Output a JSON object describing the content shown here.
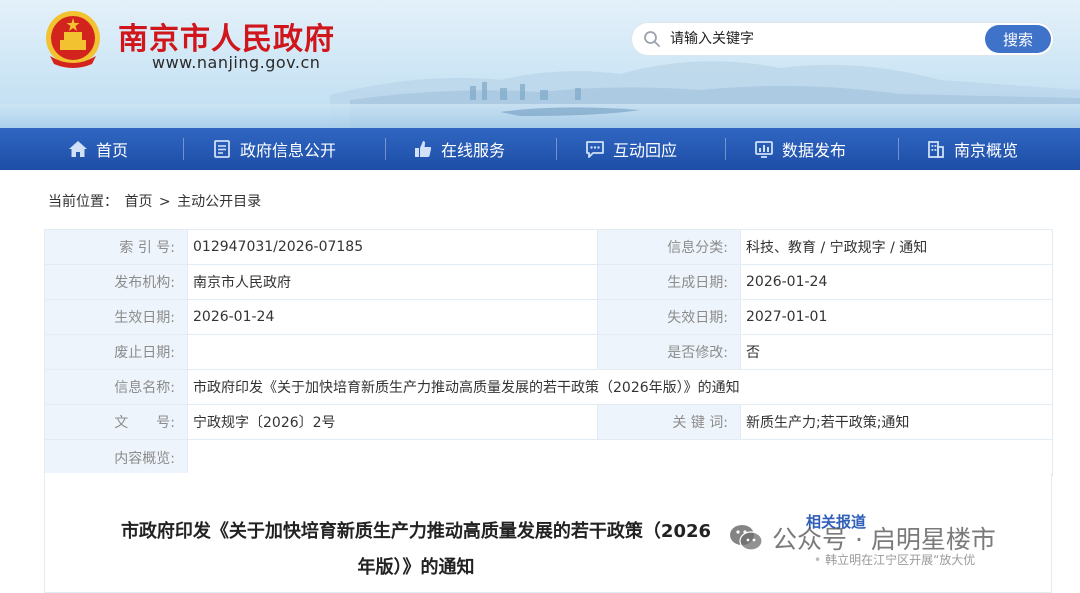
{
  "header": {
    "site_title": "南京市人民政府",
    "site_url": "www.nanjing.gov.cn",
    "emblem_icon": "national-emblem-icon",
    "search": {
      "placeholder": "请输入关键字",
      "button_label": "搜索"
    }
  },
  "nav": {
    "items": [
      {
        "label": "首页",
        "icon": "home-icon"
      },
      {
        "label": "政府信息公开",
        "icon": "document-icon"
      },
      {
        "label": "在线服务",
        "icon": "thumbs-up-icon"
      },
      {
        "label": "互动回应",
        "icon": "chat-icon"
      },
      {
        "label": "数据发布",
        "icon": "bar-chart-icon"
      },
      {
        "label": "南京概览",
        "icon": "building-icon"
      }
    ]
  },
  "breadcrumb": {
    "prefix": "当前位置：",
    "items": [
      "首页",
      "主动公开目录"
    ],
    "separator": ">"
  },
  "info": {
    "index_no": {
      "label": "索 引 号:",
      "value": "012947031/2026-07185"
    },
    "category": {
      "label": "信息分类:",
      "value": "科技、教育 / 宁政规字 / 通知"
    },
    "publisher": {
      "label": "发布机构:",
      "value": "南京市人民政府"
    },
    "created_date": {
      "label": "生成日期:",
      "value": "2026-01-24"
    },
    "effective_date": {
      "label": "生效日期:",
      "value": "2026-01-24"
    },
    "expiry_date": {
      "label": "失效日期:",
      "value": "2027-01-01"
    },
    "repeal_date": {
      "label": "废止日期:",
      "value": ""
    },
    "modified": {
      "label": "是否修改:",
      "value": "否"
    },
    "name": {
      "label": "信息名称:",
      "value": "市政府印发《关于加快培育新质生产力推动高质量发展的若干政策（2026年版）》的通知"
    },
    "doc_no": {
      "label": "文　　号:",
      "value": "宁政规字〔2026〕2号"
    },
    "keywords": {
      "label": "关 键 词:",
      "value": "新质生产力;若干政策;通知"
    },
    "summary": {
      "label": "内容概览:",
      "value": ""
    }
  },
  "article": {
    "title_line1": "市政府印发《关于加快培育新质生产力推动高质量发展的若干政策（2026",
    "title_line2": "年版）》的通知"
  },
  "related": {
    "heading": "相关报道",
    "items": [
      "韩立明在江宁区开展“放大优"
    ]
  },
  "watermark": {
    "text": "公众号 · 启明星楼市",
    "icon": "wechat-icon"
  },
  "colors": {
    "title_red": "#d0151b",
    "nav_blue": "#2659b5",
    "search_button": "#3f72c9",
    "label_bg": "#eef4fb",
    "related_blue": "#2f5fb8"
  }
}
